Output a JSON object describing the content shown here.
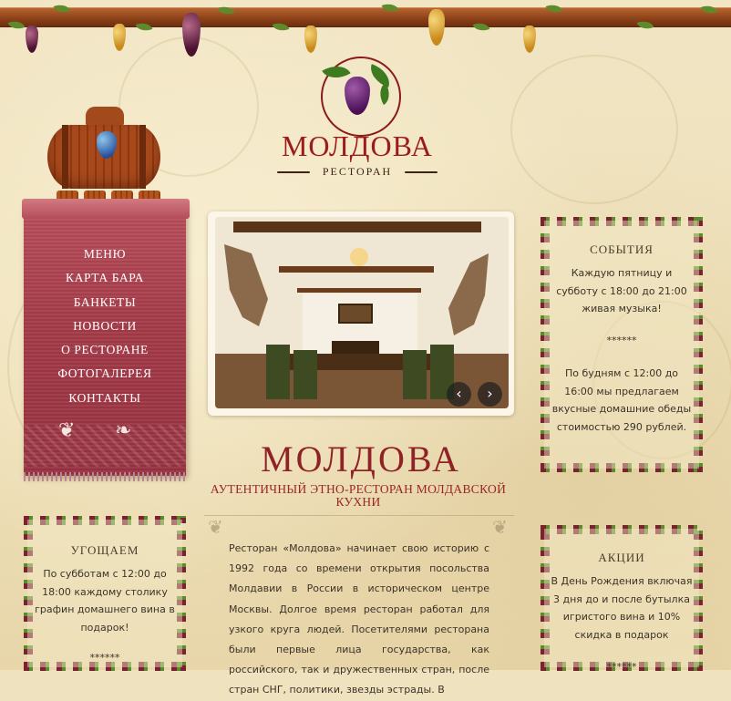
{
  "header": {
    "logo_title": "МОЛДОВА",
    "logo_subtitle": "РЕСТОРАН"
  },
  "nav": {
    "items": [
      {
        "label": "МЕНЮ"
      },
      {
        "label": "КАРТА БАРА"
      },
      {
        "label": "БАНКЕТЫ"
      },
      {
        "label": "НОВОСТИ"
      },
      {
        "label": "О РЕСТОРАНЕ"
      },
      {
        "label": "ФОТОГАЛЕРЕЯ"
      },
      {
        "label": "КОНТАКТЫ"
      }
    ]
  },
  "slideshow": {
    "prev_label": "‹",
    "next_label": "›"
  },
  "main": {
    "headline": "МОЛДОВА",
    "tagline": "АУТЕНТИЧНЫЙ ЭТНО-РЕСТОРАН МОЛДАВСКОЙ КУХНИ",
    "intro_text": "Ресторан «Молдова» начинает свою историю с 1992 года со времени открытия посольства Молдавии в России в историческом центре Москвы. Долгое время ресторан работал для узкого круга людей. Посетителями ресторана были первые лица государства, как российского, так и дружественных стран, после стран СНГ, политики, звезды эстрады. В"
  },
  "events_panel": {
    "title": "СОБЫТИЯ",
    "text1": "Каждую пятницу и субботу с 18:00 до 21:00 живая музыка!",
    "separator": "******",
    "text2": "По будням с 12:00 до 16:00 мы предлагаем вкусные домашние обеды стоимостью 290 рублей."
  },
  "treat_panel": {
    "title": "УГОЩАЕМ",
    "text1": "По субботам с 12:00 до 18:00 каждому столику графин домашнего вина в подарок!",
    "separator": "******"
  },
  "promo_panel": {
    "title": "АКЦИИ",
    "text1": "В День Рождения включая 3 дня до и после бутылка игристого вина и 10% скидка в подарок",
    "separator": "******"
  },
  "colors": {
    "accent_red": "#9b1c1a",
    "towel_red": "#a43a48",
    "text_dark": "#3c3328"
  }
}
